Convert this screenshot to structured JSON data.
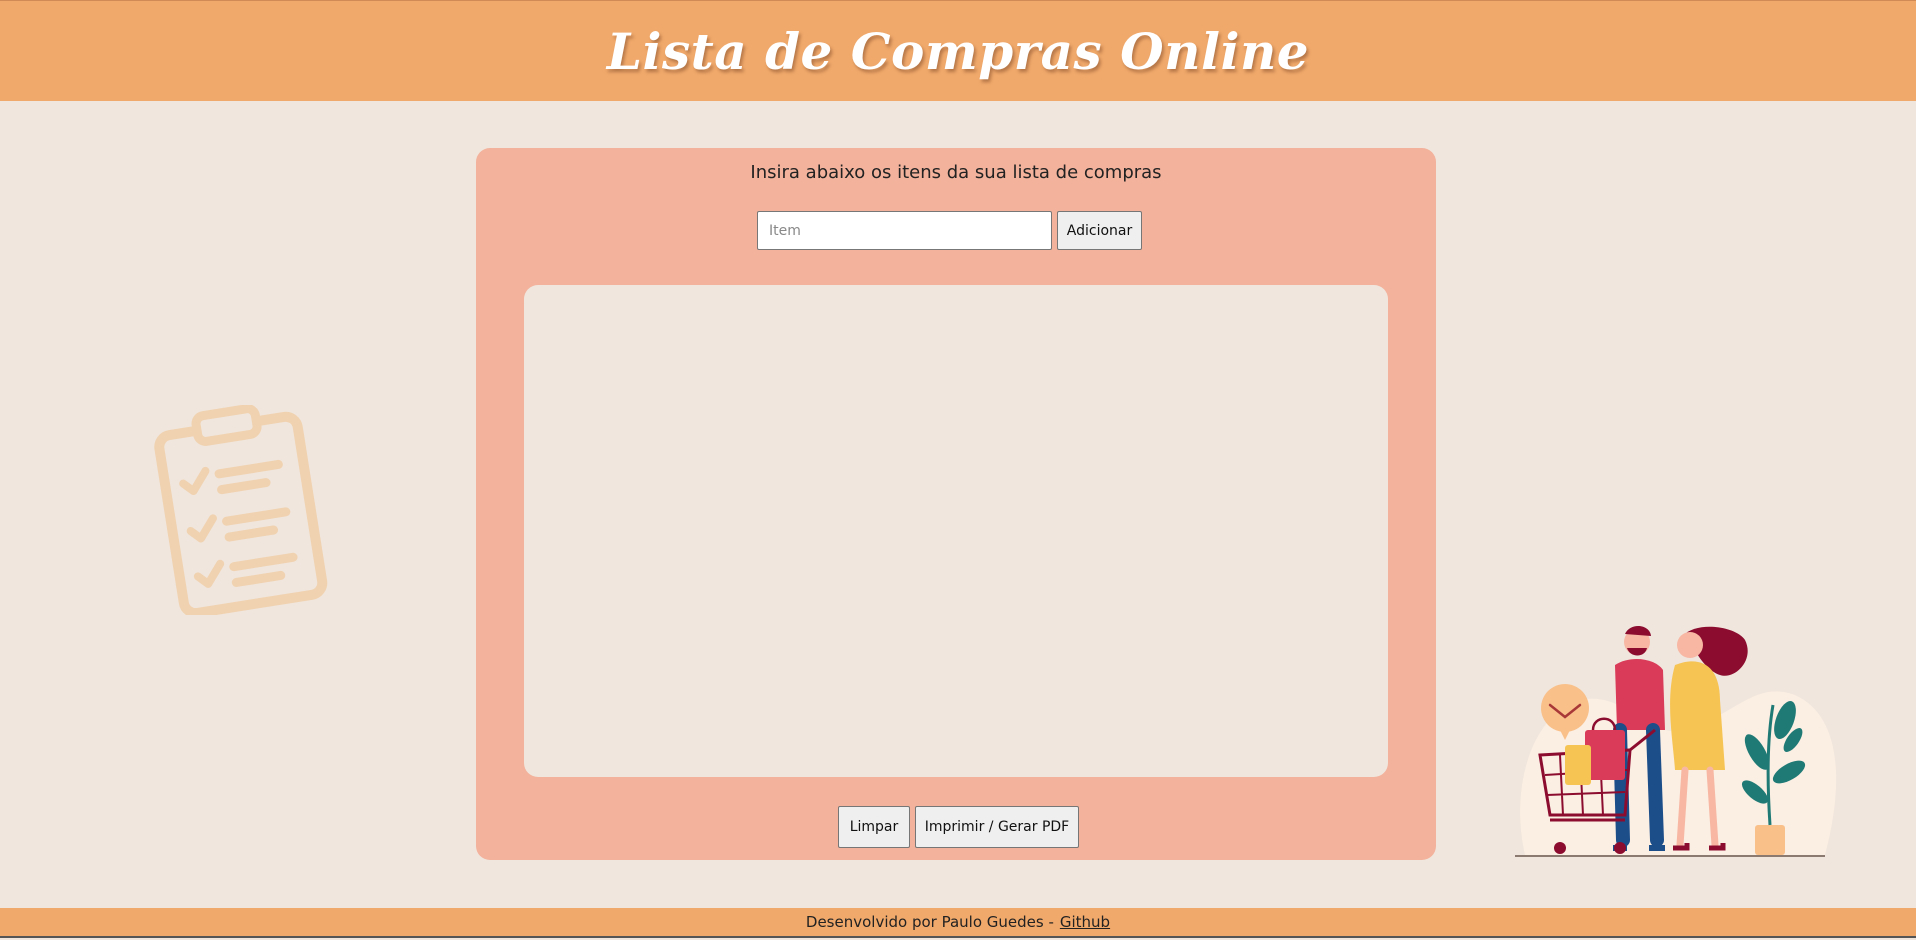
{
  "header": {
    "title": "Lista de Compras Online"
  },
  "main": {
    "instruction": "Insira abaixo os itens da sua lista de compras",
    "input": {
      "placeholder": "Item",
      "value": ""
    },
    "add_button_label": "Adicionar",
    "items": [],
    "clear_button_label": "Limpar",
    "print_button_label": "Imprimir / Gerar PDF"
  },
  "footer": {
    "text": "Desenvolvido por Paulo Guedes -",
    "link_label": "Github"
  },
  "decor": {
    "left_icon": "clipboard-checklist-icon",
    "right_illustration": "couple-shopping-cart-illustration"
  },
  "colors": {
    "header_bg": "#f1a96b",
    "page_bg": "#f0e6dd",
    "card_bg": "#f2b29c",
    "list_bg": "#f0e6dd"
  }
}
